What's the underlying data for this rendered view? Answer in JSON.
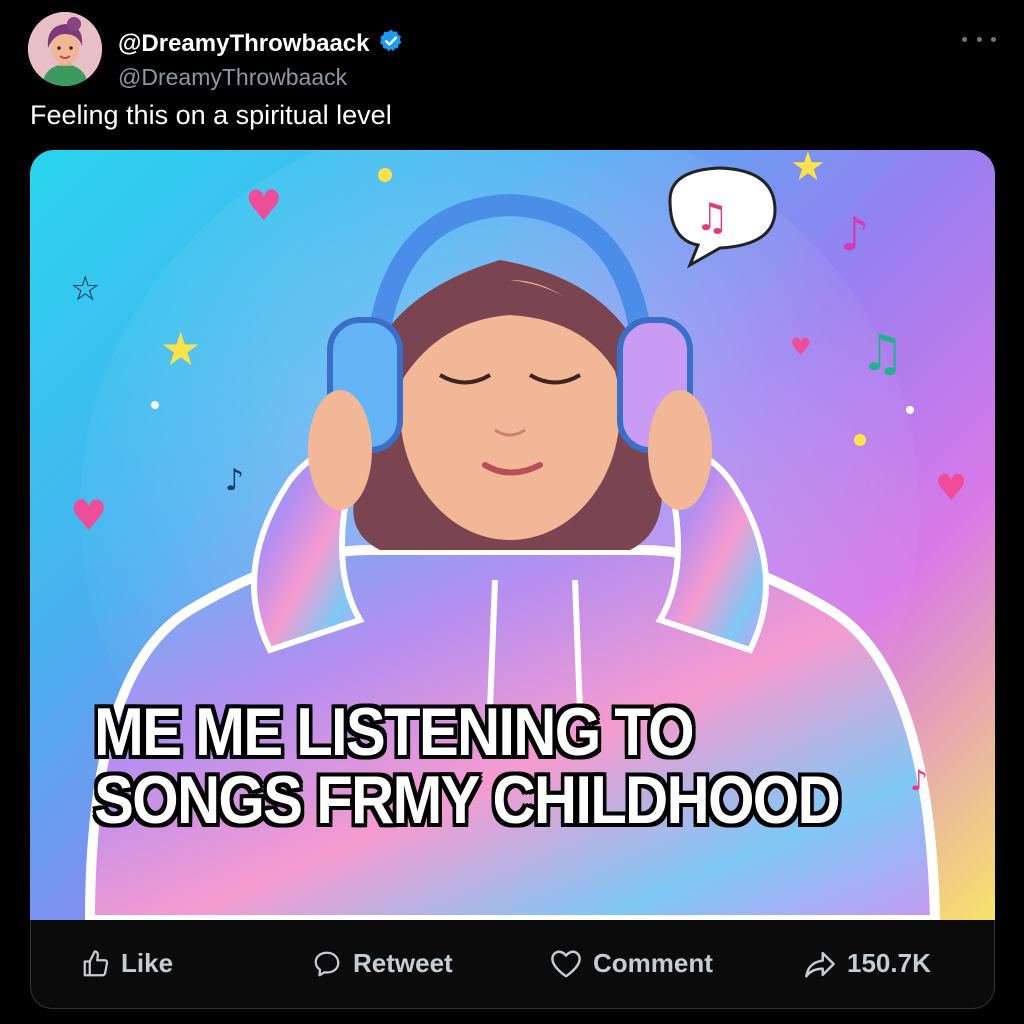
{
  "author": {
    "display_name": "@DreamyThrowbaack",
    "handle": "@DreamyThrowbaack",
    "verified": true,
    "badge_color": "#1d9bf0"
  },
  "tweet": {
    "text": "Feeling this on a spiritual level"
  },
  "media": {
    "caption_line1": "ME  ME LISTENING TO",
    "caption_line2": "SONGS FRMY CHILDHOOD"
  },
  "actions": {
    "like_label": "Like",
    "retweet_label": "Retweet",
    "comment_label": "Comment",
    "share_count": "150.7K"
  },
  "icons": [
    "more-icon",
    "verified-icon",
    "like-icon",
    "retweet-icon",
    "comment-icon",
    "share-icon"
  ]
}
